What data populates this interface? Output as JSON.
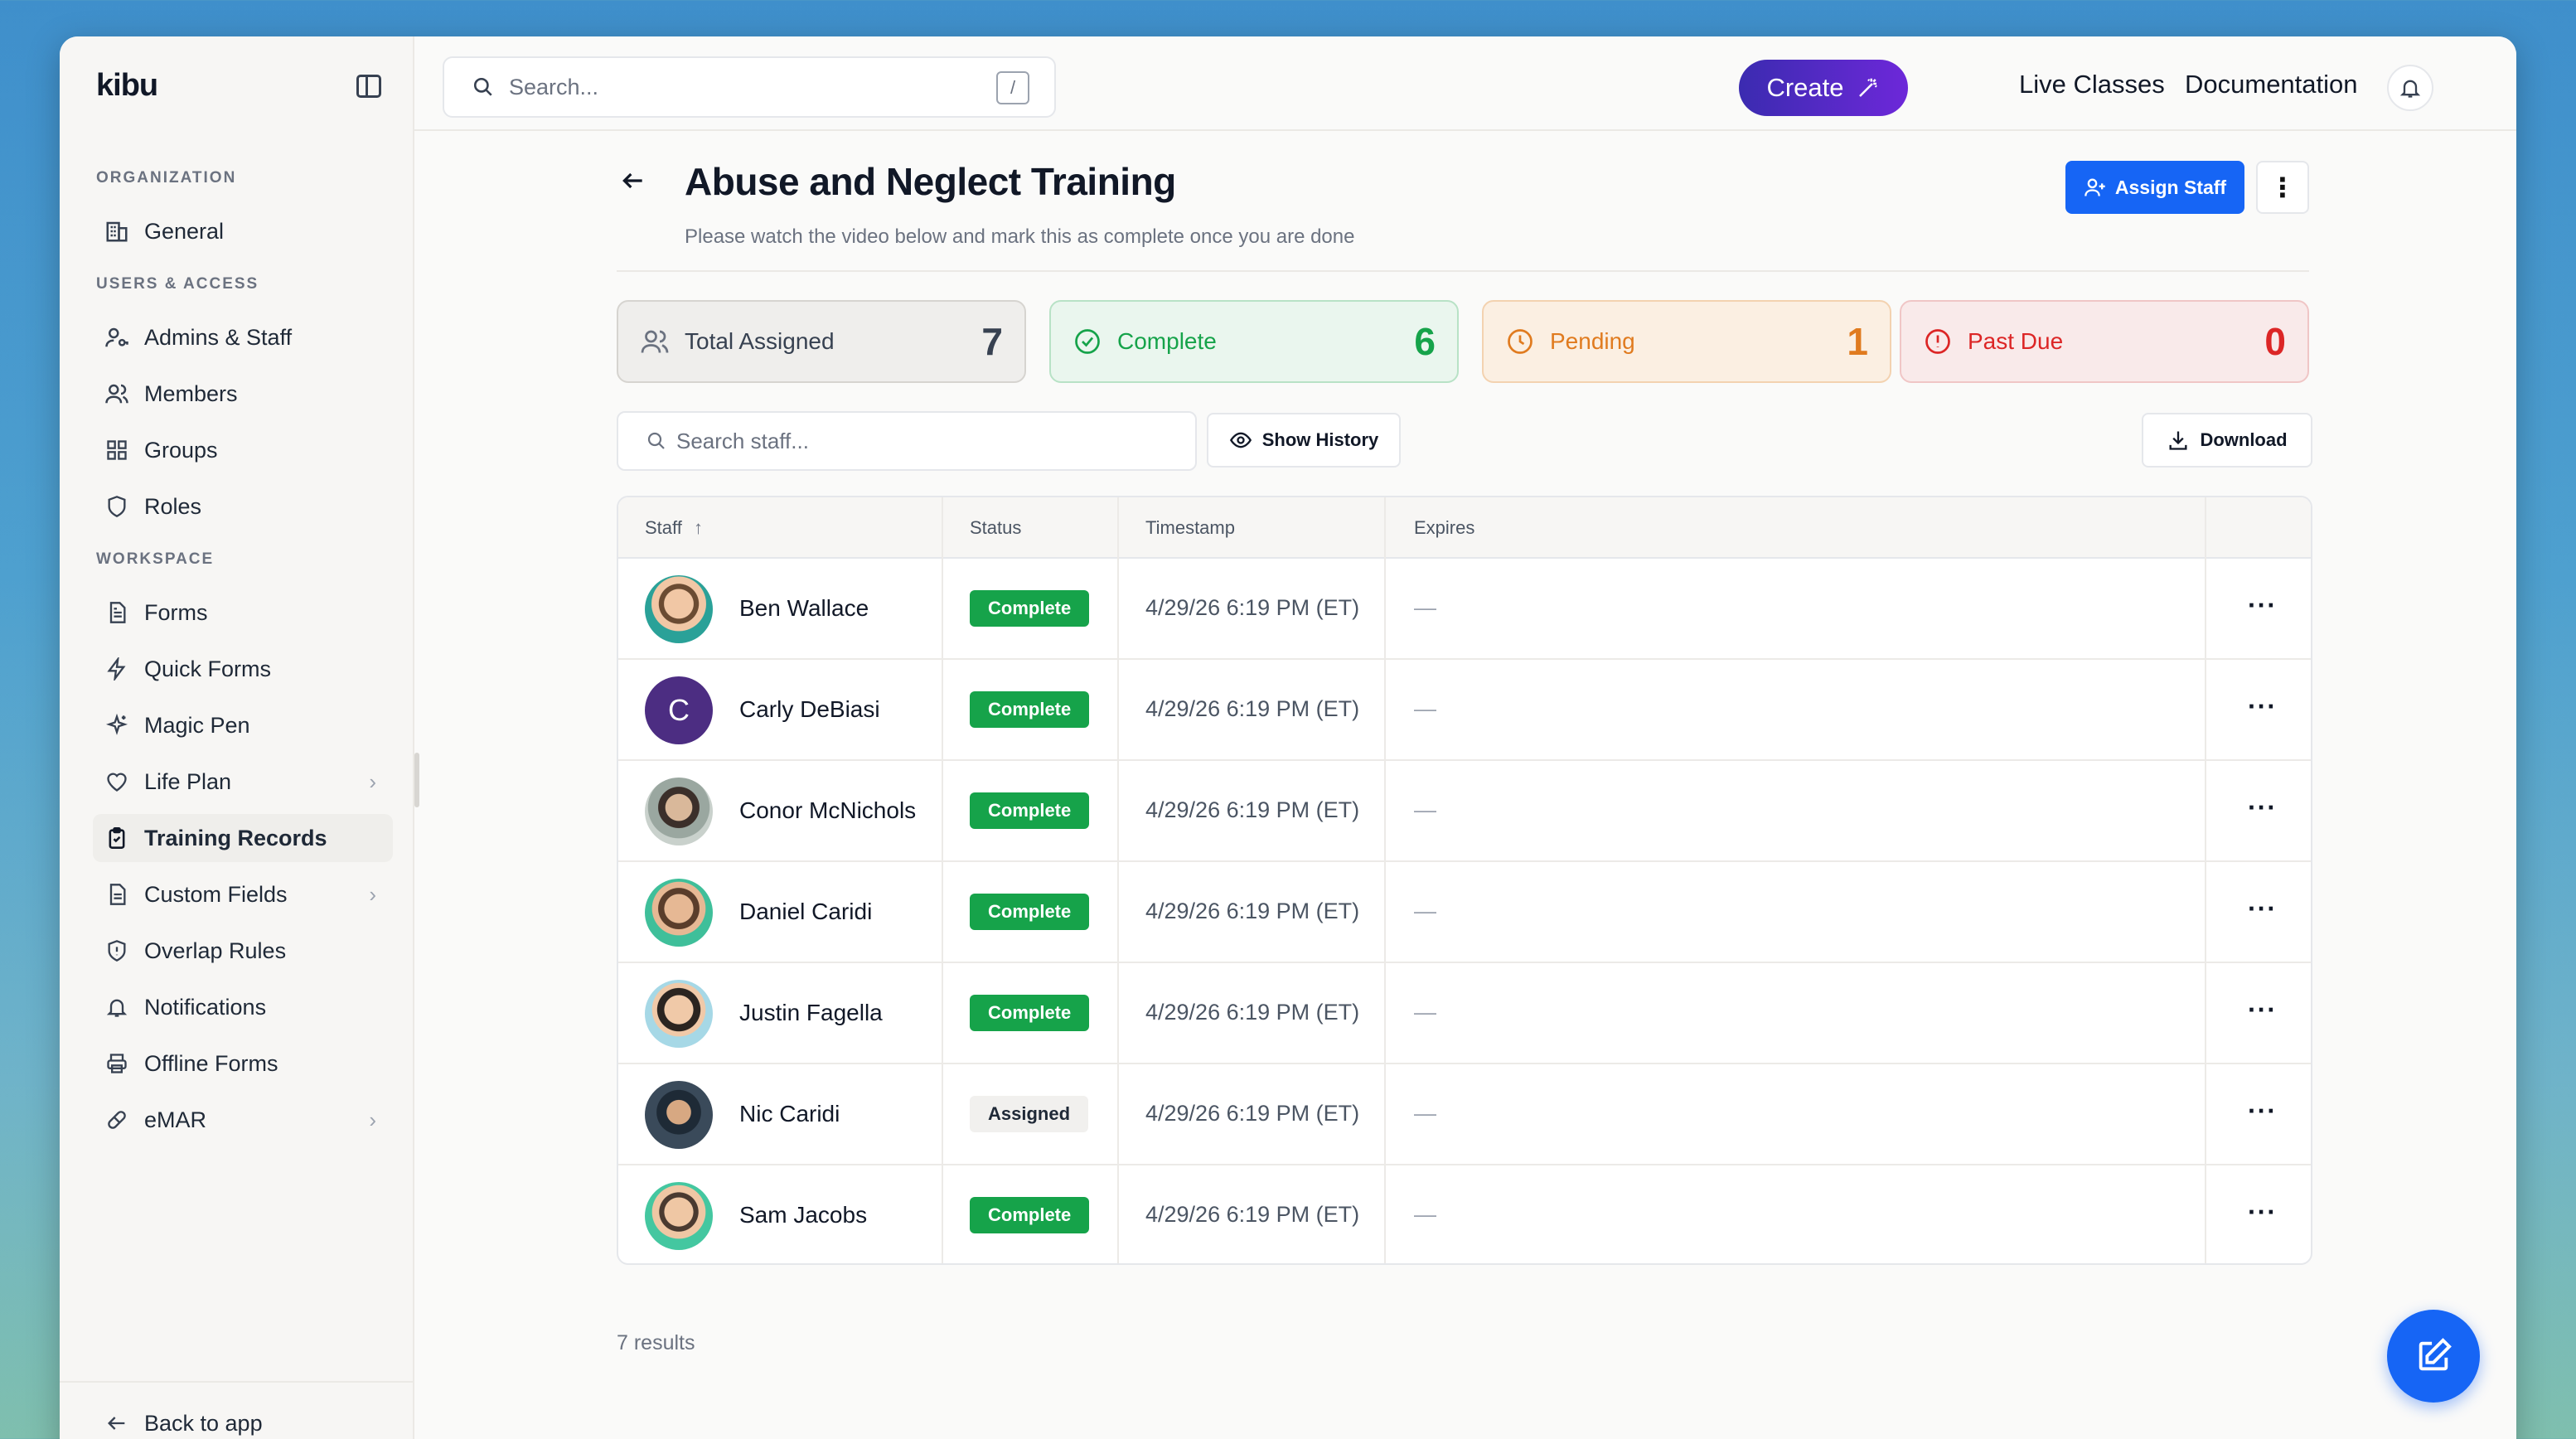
{
  "app": {
    "logo": "kibu"
  },
  "sidebar": {
    "sections": [
      {
        "label": "ORGANIZATION"
      },
      {
        "label": "USERS & ACCESS"
      },
      {
        "label": "WORKSPACE"
      }
    ],
    "items": [
      {
        "label": "General",
        "icon": "building-icon"
      },
      {
        "label": "Admins & Staff",
        "icon": "user-key-icon"
      },
      {
        "label": "Members",
        "icon": "users-icon"
      },
      {
        "label": "Groups",
        "icon": "grid-icon"
      },
      {
        "label": "Roles",
        "icon": "shield-icon"
      },
      {
        "label": "Forms",
        "icon": "document-icon"
      },
      {
        "label": "Quick Forms",
        "icon": "lightning-icon"
      },
      {
        "label": "Magic Pen",
        "icon": "sparkles-icon"
      },
      {
        "label": "Life Plan",
        "icon": "heart-icon",
        "chevron": true
      },
      {
        "label": "Training Records",
        "icon": "clipboard-check-icon",
        "active": true
      },
      {
        "label": "Custom Fields",
        "icon": "document-icon",
        "chevron": true
      },
      {
        "label": "Overlap Rules",
        "icon": "shield-alert-icon"
      },
      {
        "label": "Notifications",
        "icon": "bell-icon"
      },
      {
        "label": "Offline Forms",
        "icon": "printer-icon"
      },
      {
        "label": "eMAR",
        "icon": "pill-icon",
        "chevron": true
      }
    ],
    "back_label": "Back to app"
  },
  "topbar": {
    "search_placeholder": "Search...",
    "search_shortcut": "/",
    "create_label": "Create",
    "live_classes": "Live Classes",
    "documentation": "Documentation"
  },
  "page": {
    "title": "Abuse and Neglect Training",
    "subtitle": "Please watch the video below and mark this as complete once you are done",
    "assign_label": "Assign Staff"
  },
  "stats": [
    {
      "label": "Total Assigned",
      "value": "7",
      "color": "#374151"
    },
    {
      "label": "Complete",
      "value": "6",
      "color": "#16a34a"
    },
    {
      "label": "Pending",
      "value": "1",
      "color": "#e07b1f"
    },
    {
      "label": "Past Due",
      "value": "0",
      "color": "#dc2626"
    }
  ],
  "toolbar": {
    "search_placeholder": "Search staff...",
    "show_history": "Show History",
    "download": "Download"
  },
  "table": {
    "columns": [
      "Staff",
      "Status",
      "Timestamp",
      "Expires"
    ],
    "rows": [
      {
        "name": "Ben Wallace",
        "status": "Complete",
        "timestamp": "4/29/26 6:19 PM (ET)",
        "expires": "—"
      },
      {
        "name": "Carly DeBiasi",
        "status": "Complete",
        "timestamp": "4/29/26 6:19 PM (ET)",
        "expires": "—",
        "initial": "C"
      },
      {
        "name": "Conor McNichols",
        "status": "Complete",
        "timestamp": "4/29/26 6:19 PM (ET)",
        "expires": "—"
      },
      {
        "name": "Daniel Caridi",
        "status": "Complete",
        "timestamp": "4/29/26 6:19 PM (ET)",
        "expires": "—"
      },
      {
        "name": "Justin Fagella",
        "status": "Complete",
        "timestamp": "4/29/26 6:19 PM (ET)",
        "expires": "—"
      },
      {
        "name": "Nic Caridi",
        "status": "Assigned",
        "timestamp": "4/29/26 6:19 PM (ET)",
        "expires": "—"
      },
      {
        "name": "Sam Jacobs",
        "status": "Complete",
        "timestamp": "4/29/26 6:19 PM (ET)",
        "expires": "—"
      }
    ],
    "row_action": "···"
  },
  "results_label": "7 results"
}
